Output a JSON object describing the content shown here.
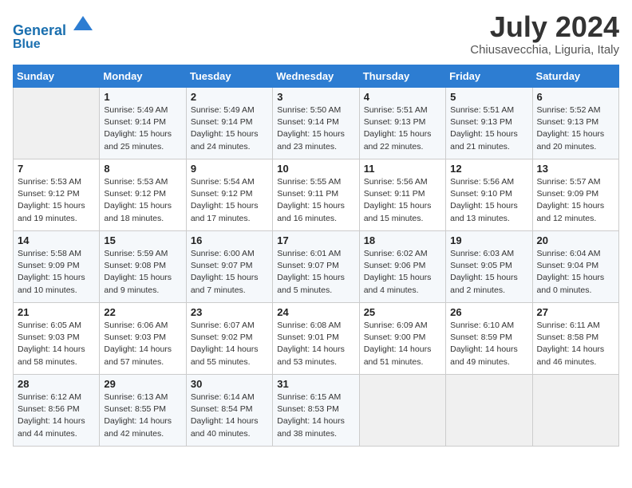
{
  "header": {
    "logo_line1": "General",
    "logo_line2": "Blue",
    "month": "July 2024",
    "location": "Chiusavecchia, Liguria, Italy"
  },
  "weekdays": [
    "Sunday",
    "Monday",
    "Tuesday",
    "Wednesday",
    "Thursday",
    "Friday",
    "Saturday"
  ],
  "weeks": [
    [
      {
        "day": "",
        "info": ""
      },
      {
        "day": "1",
        "info": "Sunrise: 5:49 AM\nSunset: 9:14 PM\nDaylight: 15 hours\nand 25 minutes."
      },
      {
        "day": "2",
        "info": "Sunrise: 5:49 AM\nSunset: 9:14 PM\nDaylight: 15 hours\nand 24 minutes."
      },
      {
        "day": "3",
        "info": "Sunrise: 5:50 AM\nSunset: 9:14 PM\nDaylight: 15 hours\nand 23 minutes."
      },
      {
        "day": "4",
        "info": "Sunrise: 5:51 AM\nSunset: 9:13 PM\nDaylight: 15 hours\nand 22 minutes."
      },
      {
        "day": "5",
        "info": "Sunrise: 5:51 AM\nSunset: 9:13 PM\nDaylight: 15 hours\nand 21 minutes."
      },
      {
        "day": "6",
        "info": "Sunrise: 5:52 AM\nSunset: 9:13 PM\nDaylight: 15 hours\nand 20 minutes."
      }
    ],
    [
      {
        "day": "7",
        "info": "Sunrise: 5:53 AM\nSunset: 9:12 PM\nDaylight: 15 hours\nand 19 minutes."
      },
      {
        "day": "8",
        "info": "Sunrise: 5:53 AM\nSunset: 9:12 PM\nDaylight: 15 hours\nand 18 minutes."
      },
      {
        "day": "9",
        "info": "Sunrise: 5:54 AM\nSunset: 9:12 PM\nDaylight: 15 hours\nand 17 minutes."
      },
      {
        "day": "10",
        "info": "Sunrise: 5:55 AM\nSunset: 9:11 PM\nDaylight: 15 hours\nand 16 minutes."
      },
      {
        "day": "11",
        "info": "Sunrise: 5:56 AM\nSunset: 9:11 PM\nDaylight: 15 hours\nand 15 minutes."
      },
      {
        "day": "12",
        "info": "Sunrise: 5:56 AM\nSunset: 9:10 PM\nDaylight: 15 hours\nand 13 minutes."
      },
      {
        "day": "13",
        "info": "Sunrise: 5:57 AM\nSunset: 9:09 PM\nDaylight: 15 hours\nand 12 minutes."
      }
    ],
    [
      {
        "day": "14",
        "info": "Sunrise: 5:58 AM\nSunset: 9:09 PM\nDaylight: 15 hours\nand 10 minutes."
      },
      {
        "day": "15",
        "info": "Sunrise: 5:59 AM\nSunset: 9:08 PM\nDaylight: 15 hours\nand 9 minutes."
      },
      {
        "day": "16",
        "info": "Sunrise: 6:00 AM\nSunset: 9:07 PM\nDaylight: 15 hours\nand 7 minutes."
      },
      {
        "day": "17",
        "info": "Sunrise: 6:01 AM\nSunset: 9:07 PM\nDaylight: 15 hours\nand 5 minutes."
      },
      {
        "day": "18",
        "info": "Sunrise: 6:02 AM\nSunset: 9:06 PM\nDaylight: 15 hours\nand 4 minutes."
      },
      {
        "day": "19",
        "info": "Sunrise: 6:03 AM\nSunset: 9:05 PM\nDaylight: 15 hours\nand 2 minutes."
      },
      {
        "day": "20",
        "info": "Sunrise: 6:04 AM\nSunset: 9:04 PM\nDaylight: 15 hours\nand 0 minutes."
      }
    ],
    [
      {
        "day": "21",
        "info": "Sunrise: 6:05 AM\nSunset: 9:03 PM\nDaylight: 14 hours\nand 58 minutes."
      },
      {
        "day": "22",
        "info": "Sunrise: 6:06 AM\nSunset: 9:03 PM\nDaylight: 14 hours\nand 57 minutes."
      },
      {
        "day": "23",
        "info": "Sunrise: 6:07 AM\nSunset: 9:02 PM\nDaylight: 14 hours\nand 55 minutes."
      },
      {
        "day": "24",
        "info": "Sunrise: 6:08 AM\nSunset: 9:01 PM\nDaylight: 14 hours\nand 53 minutes."
      },
      {
        "day": "25",
        "info": "Sunrise: 6:09 AM\nSunset: 9:00 PM\nDaylight: 14 hours\nand 51 minutes."
      },
      {
        "day": "26",
        "info": "Sunrise: 6:10 AM\nSunset: 8:59 PM\nDaylight: 14 hours\nand 49 minutes."
      },
      {
        "day": "27",
        "info": "Sunrise: 6:11 AM\nSunset: 8:58 PM\nDaylight: 14 hours\nand 46 minutes."
      }
    ],
    [
      {
        "day": "28",
        "info": "Sunrise: 6:12 AM\nSunset: 8:56 PM\nDaylight: 14 hours\nand 44 minutes."
      },
      {
        "day": "29",
        "info": "Sunrise: 6:13 AM\nSunset: 8:55 PM\nDaylight: 14 hours\nand 42 minutes."
      },
      {
        "day": "30",
        "info": "Sunrise: 6:14 AM\nSunset: 8:54 PM\nDaylight: 14 hours\nand 40 minutes."
      },
      {
        "day": "31",
        "info": "Sunrise: 6:15 AM\nSunset: 8:53 PM\nDaylight: 14 hours\nand 38 minutes."
      },
      {
        "day": "",
        "info": ""
      },
      {
        "day": "",
        "info": ""
      },
      {
        "day": "",
        "info": ""
      }
    ]
  ]
}
